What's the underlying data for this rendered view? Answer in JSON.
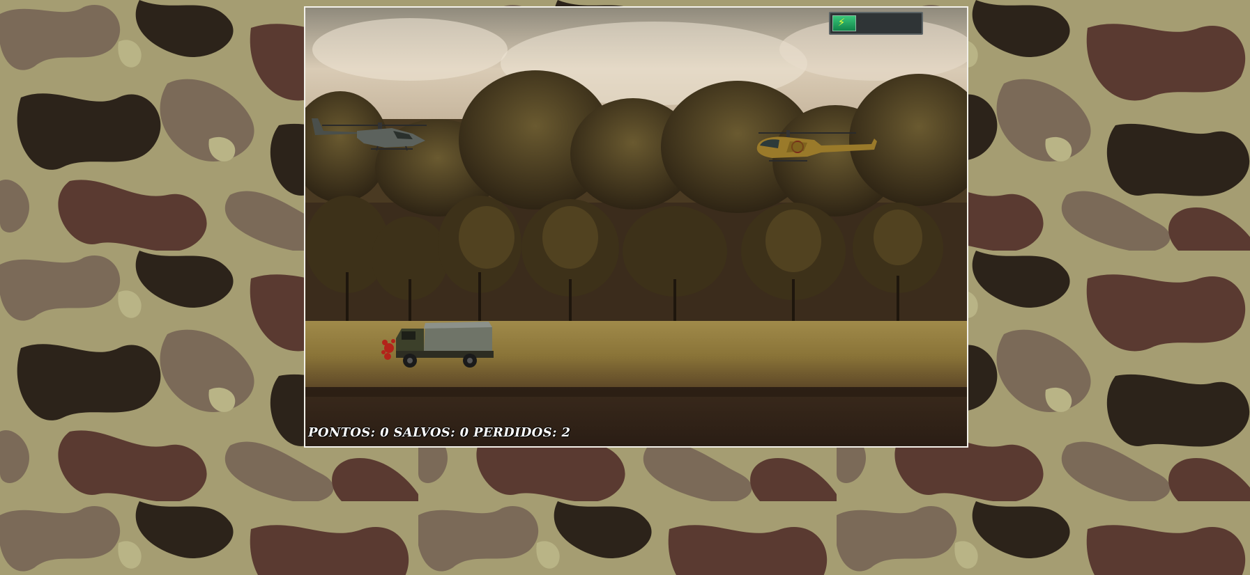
{
  "hud": {
    "points_label": "PONTOS:",
    "points_value": "0",
    "saved_label": "SALVOS:",
    "saved_value": "0",
    "lost_label": "PERDIDOS:",
    "lost_value": "2"
  },
  "energy": {
    "level": 0.27,
    "icon": "lightning-bolt-icon",
    "fill_color": "#1aa05e"
  },
  "colors": {
    "frame_border": "#f3f1ea",
    "camo_light": "#b2ad7e",
    "camo_mid": "#7d6c5a",
    "camo_brown": "#5b3a32",
    "camo_dark": "#2b2219"
  }
}
